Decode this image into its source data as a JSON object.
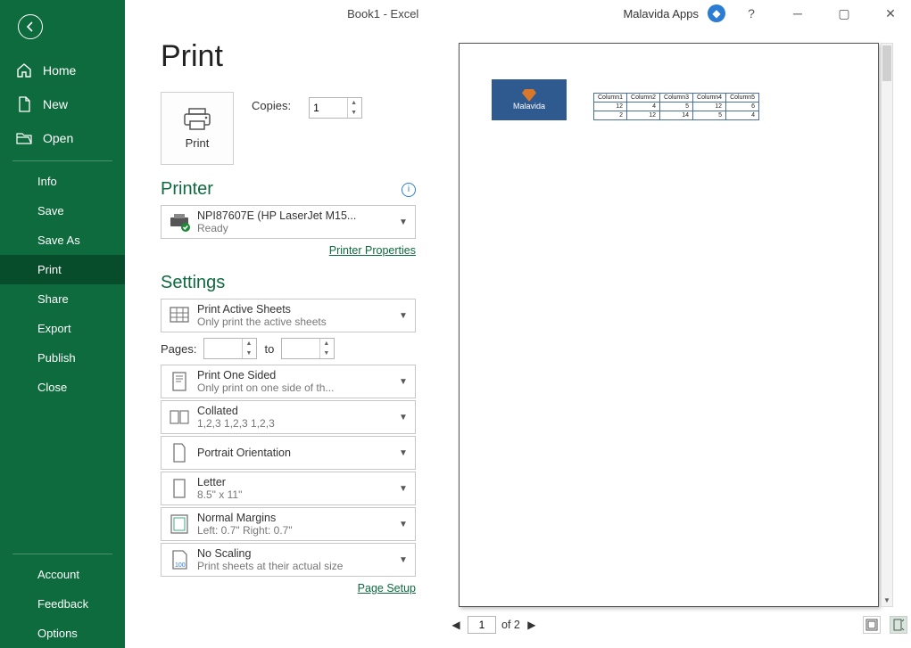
{
  "titlebar": {
    "title": "Book1  -  Excel",
    "appLabel": "Malavida Apps",
    "help": "?"
  },
  "sidebar": {
    "home": "Home",
    "new": "New",
    "open": "Open",
    "items": [
      "Info",
      "Save",
      "Save As",
      "Print",
      "Share",
      "Export",
      "Publish",
      "Close"
    ],
    "activeIndex": 3,
    "bottom": [
      "Account",
      "Feedback",
      "Options"
    ]
  },
  "page": {
    "heading": "Print",
    "printButton": "Print",
    "copiesLabel": "Copies:",
    "copiesValue": "1",
    "printerHeading": "Printer",
    "printer": {
      "name": "NPI87607E (HP LaserJet M15...",
      "status": "Ready"
    },
    "printerPropsLink": "Printer Properties",
    "settingsHeading": "Settings",
    "settings": {
      "sheets": {
        "title": "Print Active Sheets",
        "sub": "Only print the active sheets"
      },
      "pagesLabel": "Pages:",
      "pagesTo": "to",
      "pagesFrom": "",
      "pagesToVal": "",
      "sided": {
        "title": "Print One Sided",
        "sub": "Only print on one side of th..."
      },
      "collated": {
        "title": "Collated",
        "sub": "1,2,3    1,2,3    1,2,3"
      },
      "orient": {
        "title": "Portrait Orientation",
        "sub": ""
      },
      "paper": {
        "title": "Letter",
        "sub": "8.5\" x 11\""
      },
      "margins": {
        "title": "Normal Margins",
        "sub": "Left:  0.7\"    Right:  0.7\""
      },
      "scaling": {
        "title": "No Scaling",
        "sub": "Print sheets at their actual size",
        "badge": "100"
      }
    },
    "pageSetupLink": "Page Setup"
  },
  "preview": {
    "logoText": "Malavida",
    "table": {
      "headers": [
        "Column1",
        "Column2",
        "Column3",
        "Column4",
        "Column5"
      ],
      "rows": [
        [
          12,
          4,
          5,
          12,
          6
        ],
        [
          2,
          12,
          14,
          5,
          4
        ]
      ]
    },
    "pager": {
      "current": "1",
      "of": "of 2"
    }
  }
}
